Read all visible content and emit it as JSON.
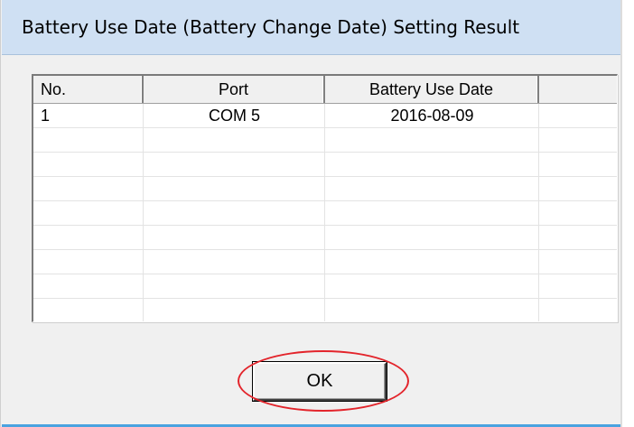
{
  "window": {
    "title": "Battery Use Date (Battery Change Date) Setting Result"
  },
  "list": {
    "columns": [
      "No.",
      "Port",
      "Battery Use Date",
      ""
    ],
    "rows": [
      {
        "no": "1",
        "port": "COM 5",
        "date": "2016-08-09"
      }
    ]
  },
  "buttons": {
    "ok_label": "OK"
  },
  "colors": {
    "highlight_ring": "#e3242b",
    "titlebar": "#cfe0f3"
  }
}
